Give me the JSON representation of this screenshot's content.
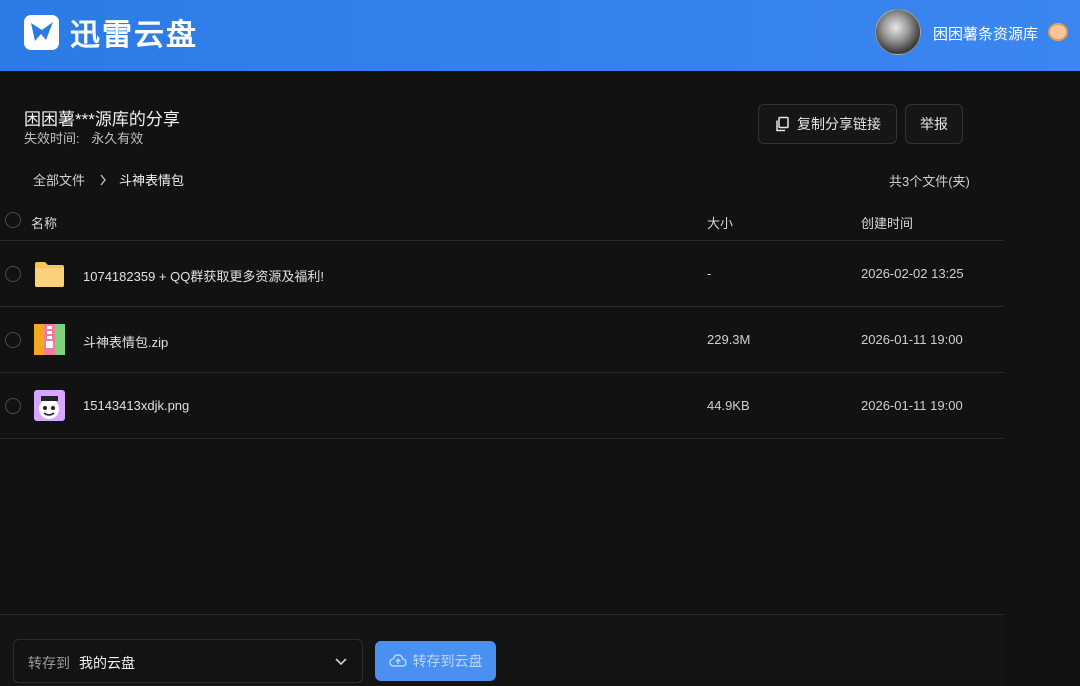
{
  "header": {
    "logo_text": "迅雷云盘",
    "username": "困困薯条资源库"
  },
  "share": {
    "title": "困困薯***源库的分享",
    "expire_label": "失效时间:",
    "expire_value": "永久有效",
    "copy_link_label": "复制分享链接",
    "report_label": "举报"
  },
  "breadcrumb": {
    "root": "全部文件",
    "current": "斗神表情包"
  },
  "file_count": "共3个文件(夹)",
  "table": {
    "columns": {
      "name": "名称",
      "size": "大小",
      "created": "创建时间"
    },
    "rows": [
      {
        "name": "1074182359 + QQ群获取更多资源及福利!",
        "size": "-",
        "created": "2026-02-02 13:25",
        "icon": "folder-icon"
      },
      {
        "name": "斗神表情包.zip",
        "size": "229.3M",
        "created": "2026-01-11 19:00",
        "icon": "zip-archive-icon"
      },
      {
        "name": "15143413xdjk.png",
        "size": "44.9KB",
        "created": "2026-01-11 19:00",
        "icon": "image-file-icon"
      }
    ]
  },
  "bottom": {
    "save_to_label": "转存到",
    "save_to_value": "我的云盘",
    "save_button_label": "转存到云盘"
  },
  "colors": {
    "header_bg": "#2c7be5",
    "page_bg": "#121212",
    "primary_button": "#4a90f0"
  }
}
